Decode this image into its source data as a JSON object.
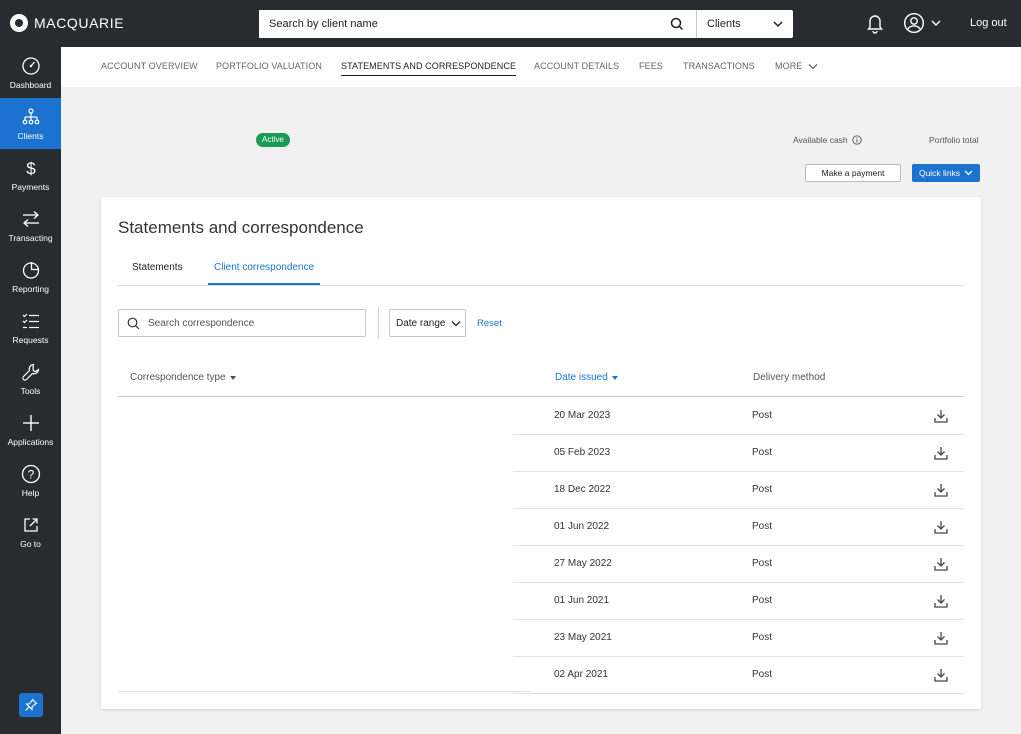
{
  "brand": {
    "name": "MACQUARIE"
  },
  "header": {
    "search_placeholder": "Search by client name",
    "scope_select": "Clients",
    "logout_label": "Log out"
  },
  "sidebar": {
    "items": [
      {
        "label": "Dashboard",
        "icon": "gauge-icon"
      },
      {
        "label": "Clients",
        "icon": "org-chart-icon",
        "active": true
      },
      {
        "label": "Payments",
        "icon": "dollar-icon"
      },
      {
        "label": "Transacting",
        "icon": "transfer-arrows-icon"
      },
      {
        "label": "Reporting",
        "icon": "pie-chart-icon"
      },
      {
        "label": "Requests",
        "icon": "checklist-icon"
      },
      {
        "label": "Tools",
        "icon": "wrench-icon"
      },
      {
        "label": "Applications",
        "icon": "plus-icon"
      },
      {
        "label": "Help",
        "icon": "question-icon"
      },
      {
        "label": "Go to",
        "icon": "external-link-icon"
      }
    ]
  },
  "tabs": [
    {
      "label": "ACCOUNT OVERVIEW"
    },
    {
      "label": "PORTFOLIO VALUATION"
    },
    {
      "label": "STATEMENTS AND CORRESPONDENCE",
      "active": true
    },
    {
      "label": "ACCOUNT DETAILS"
    },
    {
      "label": "FEES"
    },
    {
      "label": "TRANSACTIONS"
    },
    {
      "label": "MORE"
    }
  ],
  "summary": {
    "status_badge": "Active",
    "available_cash_label": "Available cash",
    "portfolio_total_label": "Portfolio total",
    "make_payment_label": "Make a payment",
    "quick_links_label": "Quick links"
  },
  "card": {
    "title": "Statements and correspondence",
    "subtabs": [
      {
        "label": "Statements"
      },
      {
        "label": "Client correspondence",
        "active": true
      }
    ],
    "search_placeholder": "Search correspondence",
    "date_range_label": "Date range",
    "reset_label": "Reset",
    "columns": {
      "type": "Correspondence type",
      "date": "Date issued",
      "method": "Delivery method"
    },
    "rows": [
      {
        "date": "20 Mar 2023",
        "method": "Post"
      },
      {
        "date": "05 Feb 2023",
        "method": "Post"
      },
      {
        "date": "18 Dec 2022",
        "method": "Post"
      },
      {
        "date": "01 Jun 2022",
        "method": "Post"
      },
      {
        "date": "27 May 2022",
        "method": "Post"
      },
      {
        "date": "01 Jun 2021",
        "method": "Post"
      },
      {
        "date": "23 May 2021",
        "method": "Post"
      },
      {
        "date": "02 Apr 2021",
        "method": "Post"
      }
    ]
  },
  "colors": {
    "accent": "#1b73cf",
    "nav_bg": "#282b30",
    "active_badge": "#1a9a55"
  }
}
